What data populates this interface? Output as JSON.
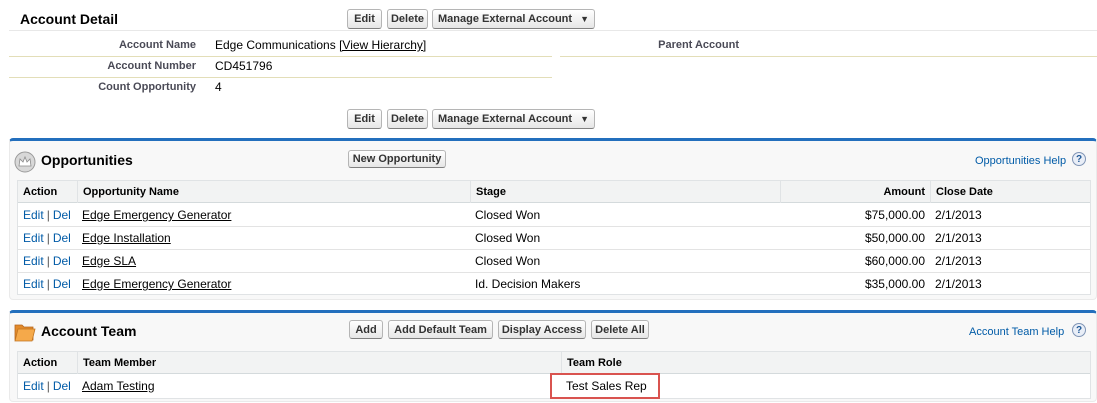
{
  "account_detail": {
    "title": "Account Detail",
    "buttons": {
      "edit": "Edit",
      "delete": "Delete",
      "manage": "Manage External Account"
    },
    "fields": {
      "account_name_label": "Account Name",
      "account_name_value": "Edge Communications",
      "view_hierarchy": "[View Hierarchy]",
      "account_number_label": "Account Number",
      "account_number_value": "CD451796",
      "count_opportunity_label": "Count Opportunity",
      "count_opportunity_value": "4",
      "parent_account_label": "Parent Account"
    }
  },
  "opportunities": {
    "title": "Opportunities",
    "new_button": "New Opportunity",
    "help_link": "Opportunities Help",
    "help_icon": "?",
    "columns": {
      "action": "Action",
      "name": "Opportunity Name",
      "stage": "Stage",
      "amount": "Amount",
      "close_date": "Close Date"
    },
    "action_edit": "Edit",
    "action_sep": "|",
    "action_del": "Del",
    "rows": [
      {
        "name": "Edge Emergency Generator",
        "stage": "Closed Won",
        "amount": "$75,000.00",
        "close_date": "2/1/2013"
      },
      {
        "name": "Edge Installation",
        "stage": "Closed Won",
        "amount": "$50,000.00",
        "close_date": "2/1/2013"
      },
      {
        "name": "Edge SLA",
        "stage": "Closed Won",
        "amount": "$60,000.00",
        "close_date": "2/1/2013"
      },
      {
        "name": "Edge Emergency Generator",
        "stage": "Id. Decision Makers",
        "amount": "$35,000.00",
        "close_date": "2/1/2013"
      }
    ]
  },
  "account_team": {
    "title": "Account Team",
    "buttons": {
      "add": "Add",
      "add_default": "Add Default Team",
      "display_access": "Display Access",
      "delete_all": "Delete All"
    },
    "help_link": "Account Team Help",
    "help_icon": "?",
    "columns": {
      "action": "Action",
      "member": "Team Member",
      "role": "Team Role"
    },
    "rows": [
      {
        "edit": "Edit",
        "sep": "|",
        "del": "Del",
        "member": "Adam Testing",
        "role": "Test Sales Rep"
      }
    ]
  },
  "colors": {
    "panel_border_top": "#236fbd",
    "link_blue": "#015ba7",
    "highlight_red": "#d9534f"
  },
  "icons": {
    "opportunities": "crown-icon",
    "account_team": "folder-icon",
    "dropdown": "caret-down-icon"
  }
}
